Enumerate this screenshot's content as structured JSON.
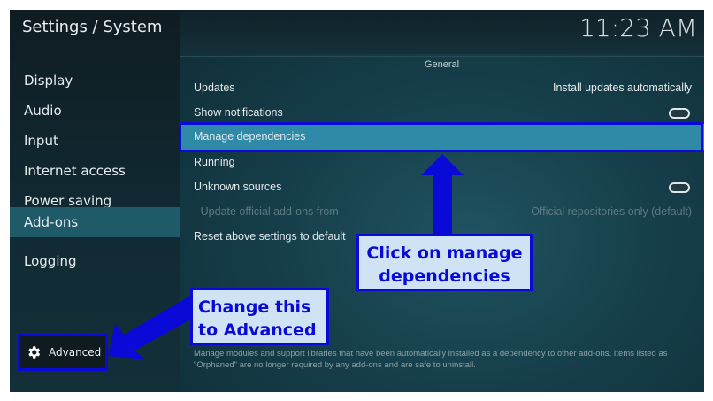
{
  "header": {
    "title": "Settings / System",
    "clock": "11:23 AM"
  },
  "sidebar": {
    "items": [
      {
        "label": "Display"
      },
      {
        "label": "Audio"
      },
      {
        "label": "Input"
      },
      {
        "label": "Internet access"
      },
      {
        "label": "Power saving"
      },
      {
        "label": "Add-ons",
        "active": true
      },
      {
        "label": "Logging"
      }
    ],
    "level_button": {
      "label": "Advanced",
      "icon": "gear-icon"
    }
  },
  "main": {
    "section_title": "General",
    "rows": [
      {
        "label": "Updates",
        "value": "Install updates automatically"
      },
      {
        "label": "Show notifications",
        "toggle": "off"
      },
      {
        "label": "Manage dependencies",
        "focused": true
      },
      {
        "label": "Running"
      },
      {
        "label": "Unknown sources",
        "toggle": "off"
      },
      {
        "label": "- Update official add-ons from",
        "value": "Official repositories only (default)",
        "disabled": true
      },
      {
        "label": "Reset above settings to default"
      }
    ],
    "description": "Manage modules and support libraries that have been automatically installed as a dependency to other add-ons. Items listed as \"Orphaned\" are no longer required by any add-ons and are safe to uninstall."
  },
  "annotations": {
    "callout_manage": "Click on manage dependencies",
    "callout_advanced": "Change this to Advanced",
    "color": "#0a0ad8",
    "fill": "#cfe3f5"
  }
}
